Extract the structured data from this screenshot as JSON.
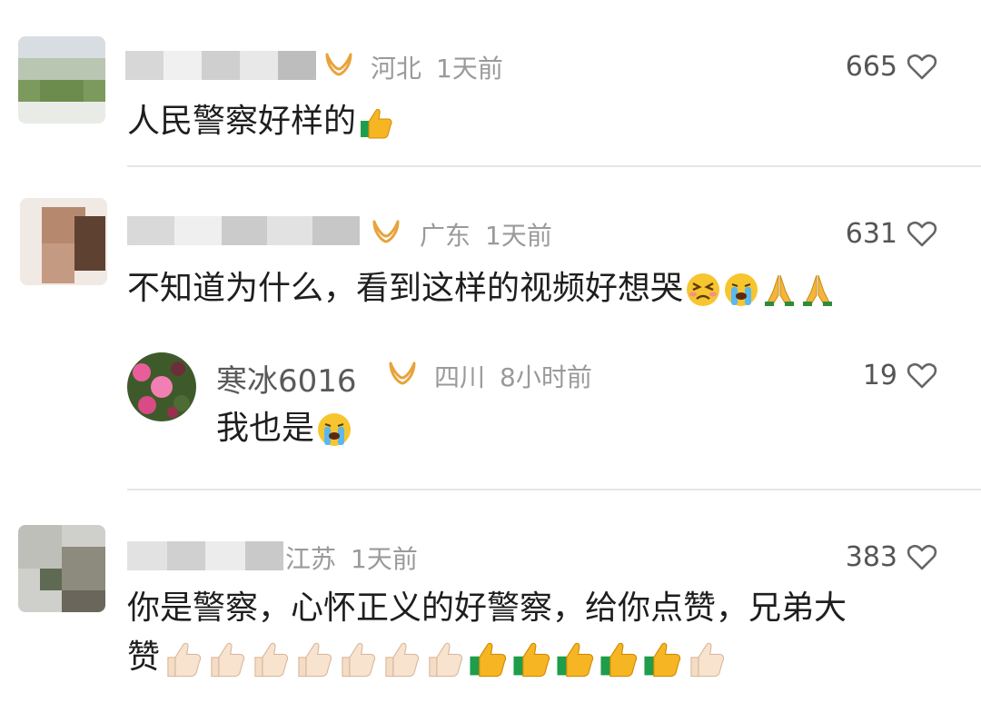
{
  "comments": [
    {
      "location": "河北",
      "time": "1天前",
      "likes": "665",
      "text": "人民警察好样的",
      "emojis": [
        "thumbs-up-green"
      ]
    },
    {
      "location": "广东",
      "time": "1天前",
      "likes": "631",
      "text": "不知道为什么，看到这样的视频好想哭",
      "emojis": [
        "persevering-face",
        "crying-face",
        "praying-hands",
        "praying-hands"
      ],
      "reply": {
        "username": "寒冰6016",
        "location": "四川",
        "time": "8小时前",
        "likes": "19",
        "text": "我也是",
        "emojis": [
          "crying-face"
        ]
      }
    },
    {
      "location": "江苏",
      "time": "1天前",
      "likes": "383",
      "text_line1": "你是警察，心怀正义的好警察，给你点赞，兄弟大",
      "text_line2": "赞",
      "emojis": [
        "thumbs-up-light",
        "thumbs-up-light",
        "thumbs-up-light",
        "thumbs-up-light",
        "thumbs-up-light",
        "thumbs-up-light",
        "thumbs-up-light",
        "thumbs-up-green",
        "thumbs-up-green",
        "thumbs-up-green",
        "thumbs-up-green",
        "thumbs-up-green",
        "thumbs-up-light"
      ]
    }
  ],
  "icons": {
    "badge": "vip-badge-icon",
    "heart": "heart-outline-icon"
  },
  "colors": {
    "badge": "#e8a33a",
    "heart": "#666666",
    "meta": "#9a9a9a",
    "divider": "#e6e6e6"
  }
}
